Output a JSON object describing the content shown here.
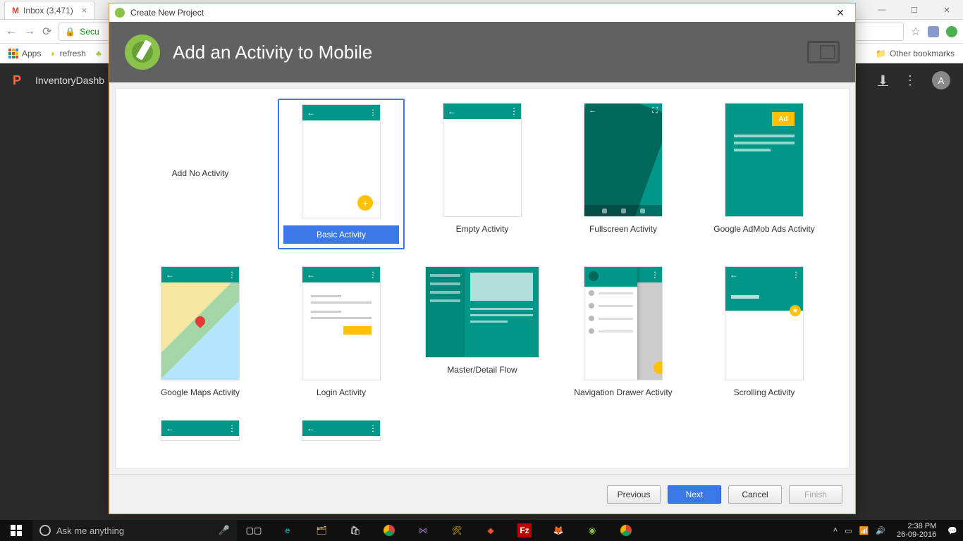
{
  "chrome": {
    "tab_title": "Inbox (3,471)",
    "omnibox": "Secu",
    "bookmarks": {
      "apps": "Apps",
      "refresh": "refresh",
      "other": "Other bookmarks"
    }
  },
  "appbar": {
    "title": "InventoryDashb",
    "avatar": "A"
  },
  "dialog": {
    "window_title": "Create New Project",
    "header": "Add an Activity to Mobile",
    "activities": [
      {
        "label": "Add No Activity",
        "no_thumb": true
      },
      {
        "label": "Basic Activity",
        "selected": true,
        "kind": "basic"
      },
      {
        "label": "Empty Activity",
        "kind": "empty"
      },
      {
        "label": "Fullscreen Activity",
        "kind": "full"
      },
      {
        "label": "Google AdMob Ads Activity",
        "kind": "admob"
      },
      {
        "label": "Google Maps Activity",
        "kind": "maps"
      },
      {
        "label": "Login Activity",
        "kind": "login"
      },
      {
        "label": "Master/Detail Flow",
        "kind": "md"
      },
      {
        "label": "Navigation Drawer Activity",
        "kind": "nav"
      },
      {
        "label": "Scrolling Activity",
        "kind": "scroll"
      },
      {
        "label": "",
        "kind": "partial"
      },
      {
        "label": "",
        "kind": "partial"
      }
    ],
    "ad_label": "Ad",
    "buttons": {
      "previous": "Previous",
      "next": "Next",
      "cancel": "Cancel",
      "finish": "Finish"
    }
  },
  "taskbar": {
    "search_placeholder": "Ask me anything",
    "time": "2:38 PM",
    "date": "26-09-2016"
  }
}
